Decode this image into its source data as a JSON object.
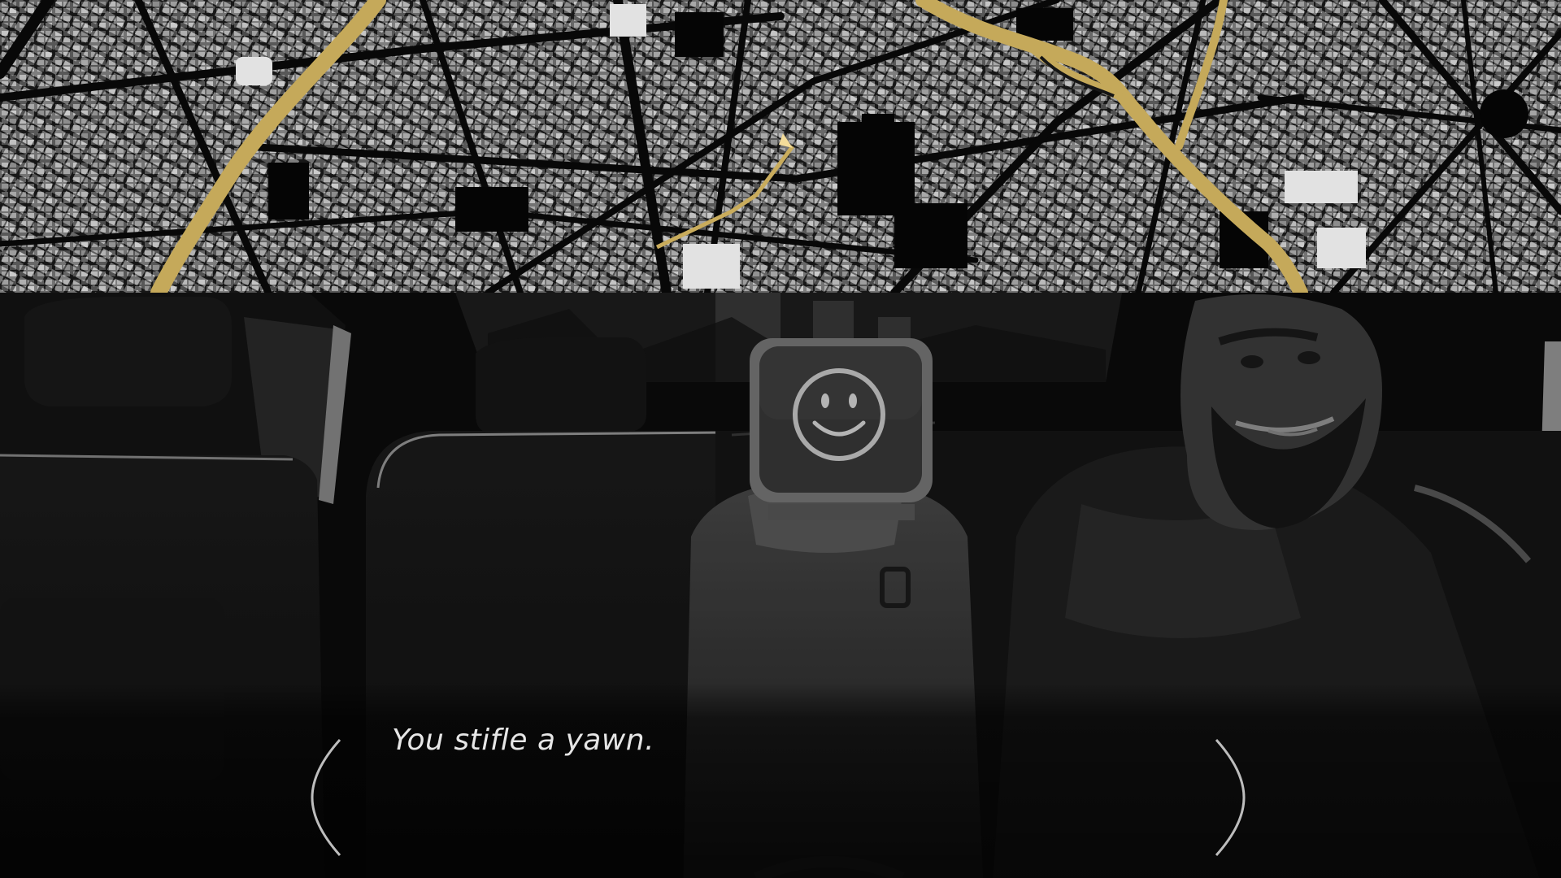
{
  "map": {
    "route_color": "#c9ac5c",
    "river_color": "#c5a95a"
  },
  "characters": {
    "passenger_left": "tv-head-smiley",
    "passenger_right": "bearded-man"
  },
  "dialogue": {
    "text": "You stifle a yawn."
  }
}
